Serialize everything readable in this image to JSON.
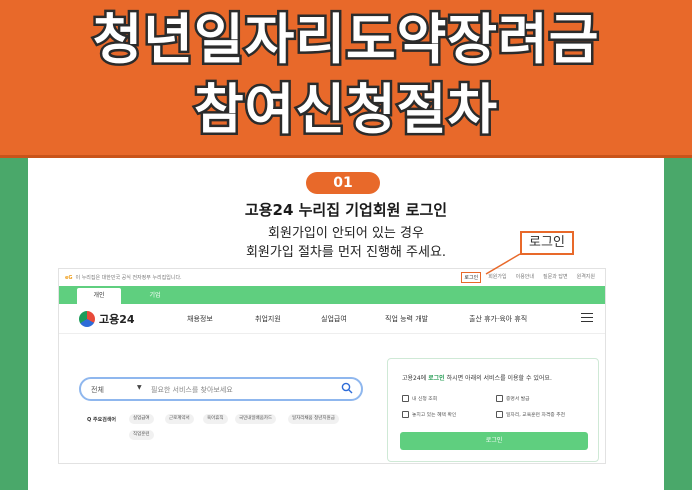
{
  "banner": {
    "line1": "청년일자리도약장려금",
    "line2": "참여신청절차"
  },
  "step": {
    "number": "01",
    "title": "고용24 누리집 기업회원 로그인",
    "desc_line1": "회원가입이 안되어 있는 경우",
    "desc_line2": "회원가입 절차를 먼저 진행해 주세요.",
    "callout": "로그인"
  },
  "site": {
    "util_logo": "eG",
    "util_text": "이 누리집은 대한민국 공식 전자정부 누리집입니다.",
    "util_links": [
      "로그인",
      "회원가입",
      "이용안내",
      "질문과 답변",
      "원격지원"
    ],
    "tabs": [
      "개인",
      "기업"
    ],
    "brand": "고용24",
    "menu": [
      "채용정보",
      "취업지원",
      "실업급여",
      "직업 능력 개발",
      "출산 휴가·육아 휴직"
    ],
    "search": {
      "select": "전체",
      "placeholder": "필요한 서비스를 찾아보세요"
    },
    "popular_label": "Q 주요검색어",
    "chips": [
      "실업급여",
      "근로계약서",
      "육아휴직",
      "국민내일배움카드",
      "일자리채움 청년지원금",
      "직업훈련"
    ],
    "login_panel": {
      "msg_before": "고용24에 ",
      "msg_highlight": "로그인",
      "msg_after": " 하시면 아래의 서비스를 이용할 수 있어요.",
      "items": [
        "내 신청 조회",
        "증명서 발급",
        "놓치고 있는 혜택 확인",
        "일자리, 교육훈련 자격증 추천"
      ],
      "button": "로그인"
    }
  },
  "colors": {
    "accent_orange": "#e8692a",
    "background_green": "#4aa86a",
    "site_green": "#5fcf7f"
  }
}
